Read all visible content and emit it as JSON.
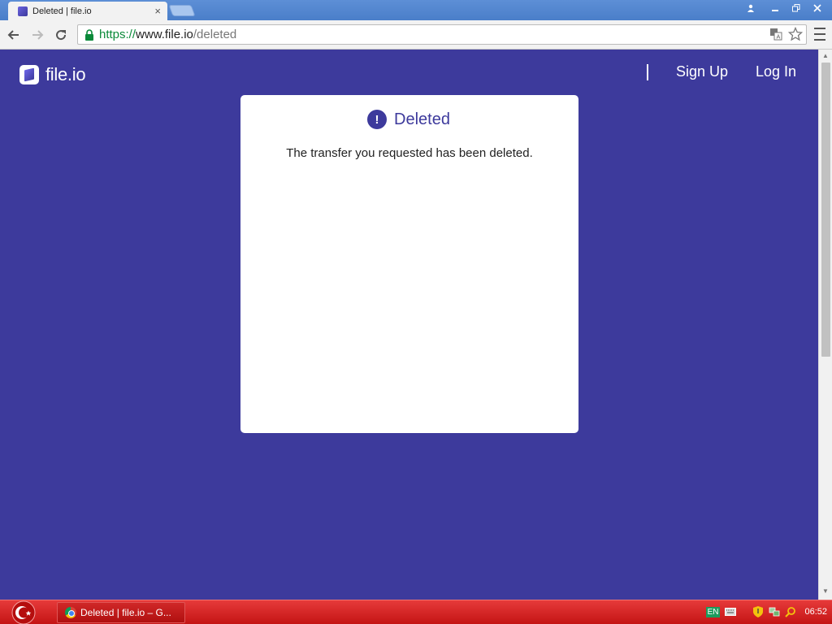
{
  "browser": {
    "tab_title": "Deleted | file.io",
    "tab_close": "×",
    "url_scheme": "https://",
    "url_host": "www.file.io",
    "url_path": "/deleted"
  },
  "page": {
    "logo_text": "file.io",
    "nav": {
      "signup": "Sign Up",
      "login": "Log In"
    },
    "card": {
      "icon": "!",
      "title": "Deleted",
      "message": "The transfer you requested has been deleted."
    },
    "brand_color": "#3d3a9c"
  },
  "taskbar": {
    "task_label": "Deleted | file.io – G...",
    "language": "EN",
    "clock": "06:52"
  }
}
